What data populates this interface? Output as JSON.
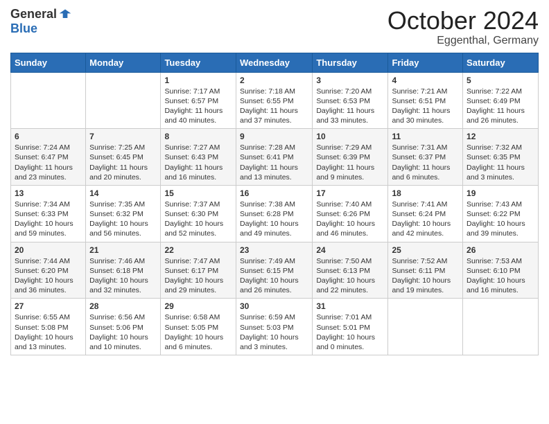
{
  "logo": {
    "general": "General",
    "blue": "Blue"
  },
  "title": "October 2024",
  "location": "Eggenthal, Germany",
  "days_of_week": [
    "Sunday",
    "Monday",
    "Tuesday",
    "Wednesday",
    "Thursday",
    "Friday",
    "Saturday"
  ],
  "weeks": [
    [
      {
        "day": "",
        "info": ""
      },
      {
        "day": "",
        "info": ""
      },
      {
        "day": "1",
        "info": "Sunrise: 7:17 AM\nSunset: 6:57 PM\nDaylight: 11 hours and 40 minutes."
      },
      {
        "day": "2",
        "info": "Sunrise: 7:18 AM\nSunset: 6:55 PM\nDaylight: 11 hours and 37 minutes."
      },
      {
        "day": "3",
        "info": "Sunrise: 7:20 AM\nSunset: 6:53 PM\nDaylight: 11 hours and 33 minutes."
      },
      {
        "day": "4",
        "info": "Sunrise: 7:21 AM\nSunset: 6:51 PM\nDaylight: 11 hours and 30 minutes."
      },
      {
        "day": "5",
        "info": "Sunrise: 7:22 AM\nSunset: 6:49 PM\nDaylight: 11 hours and 26 minutes."
      }
    ],
    [
      {
        "day": "6",
        "info": "Sunrise: 7:24 AM\nSunset: 6:47 PM\nDaylight: 11 hours and 23 minutes."
      },
      {
        "day": "7",
        "info": "Sunrise: 7:25 AM\nSunset: 6:45 PM\nDaylight: 11 hours and 20 minutes."
      },
      {
        "day": "8",
        "info": "Sunrise: 7:27 AM\nSunset: 6:43 PM\nDaylight: 11 hours and 16 minutes."
      },
      {
        "day": "9",
        "info": "Sunrise: 7:28 AM\nSunset: 6:41 PM\nDaylight: 11 hours and 13 minutes."
      },
      {
        "day": "10",
        "info": "Sunrise: 7:29 AM\nSunset: 6:39 PM\nDaylight: 11 hours and 9 minutes."
      },
      {
        "day": "11",
        "info": "Sunrise: 7:31 AM\nSunset: 6:37 PM\nDaylight: 11 hours and 6 minutes."
      },
      {
        "day": "12",
        "info": "Sunrise: 7:32 AM\nSunset: 6:35 PM\nDaylight: 11 hours and 3 minutes."
      }
    ],
    [
      {
        "day": "13",
        "info": "Sunrise: 7:34 AM\nSunset: 6:33 PM\nDaylight: 10 hours and 59 minutes."
      },
      {
        "day": "14",
        "info": "Sunrise: 7:35 AM\nSunset: 6:32 PM\nDaylight: 10 hours and 56 minutes."
      },
      {
        "day": "15",
        "info": "Sunrise: 7:37 AM\nSunset: 6:30 PM\nDaylight: 10 hours and 52 minutes."
      },
      {
        "day": "16",
        "info": "Sunrise: 7:38 AM\nSunset: 6:28 PM\nDaylight: 10 hours and 49 minutes."
      },
      {
        "day": "17",
        "info": "Sunrise: 7:40 AM\nSunset: 6:26 PM\nDaylight: 10 hours and 46 minutes."
      },
      {
        "day": "18",
        "info": "Sunrise: 7:41 AM\nSunset: 6:24 PM\nDaylight: 10 hours and 42 minutes."
      },
      {
        "day": "19",
        "info": "Sunrise: 7:43 AM\nSunset: 6:22 PM\nDaylight: 10 hours and 39 minutes."
      }
    ],
    [
      {
        "day": "20",
        "info": "Sunrise: 7:44 AM\nSunset: 6:20 PM\nDaylight: 10 hours and 36 minutes."
      },
      {
        "day": "21",
        "info": "Sunrise: 7:46 AM\nSunset: 6:18 PM\nDaylight: 10 hours and 32 minutes."
      },
      {
        "day": "22",
        "info": "Sunrise: 7:47 AM\nSunset: 6:17 PM\nDaylight: 10 hours and 29 minutes."
      },
      {
        "day": "23",
        "info": "Sunrise: 7:49 AM\nSunset: 6:15 PM\nDaylight: 10 hours and 26 minutes."
      },
      {
        "day": "24",
        "info": "Sunrise: 7:50 AM\nSunset: 6:13 PM\nDaylight: 10 hours and 22 minutes."
      },
      {
        "day": "25",
        "info": "Sunrise: 7:52 AM\nSunset: 6:11 PM\nDaylight: 10 hours and 19 minutes."
      },
      {
        "day": "26",
        "info": "Sunrise: 7:53 AM\nSunset: 6:10 PM\nDaylight: 10 hours and 16 minutes."
      }
    ],
    [
      {
        "day": "27",
        "info": "Sunrise: 6:55 AM\nSunset: 5:08 PM\nDaylight: 10 hours and 13 minutes."
      },
      {
        "day": "28",
        "info": "Sunrise: 6:56 AM\nSunset: 5:06 PM\nDaylight: 10 hours and 10 minutes."
      },
      {
        "day": "29",
        "info": "Sunrise: 6:58 AM\nSunset: 5:05 PM\nDaylight: 10 hours and 6 minutes."
      },
      {
        "day": "30",
        "info": "Sunrise: 6:59 AM\nSunset: 5:03 PM\nDaylight: 10 hours and 3 minutes."
      },
      {
        "day": "31",
        "info": "Sunrise: 7:01 AM\nSunset: 5:01 PM\nDaylight: 10 hours and 0 minutes."
      },
      {
        "day": "",
        "info": ""
      },
      {
        "day": "",
        "info": ""
      }
    ]
  ]
}
